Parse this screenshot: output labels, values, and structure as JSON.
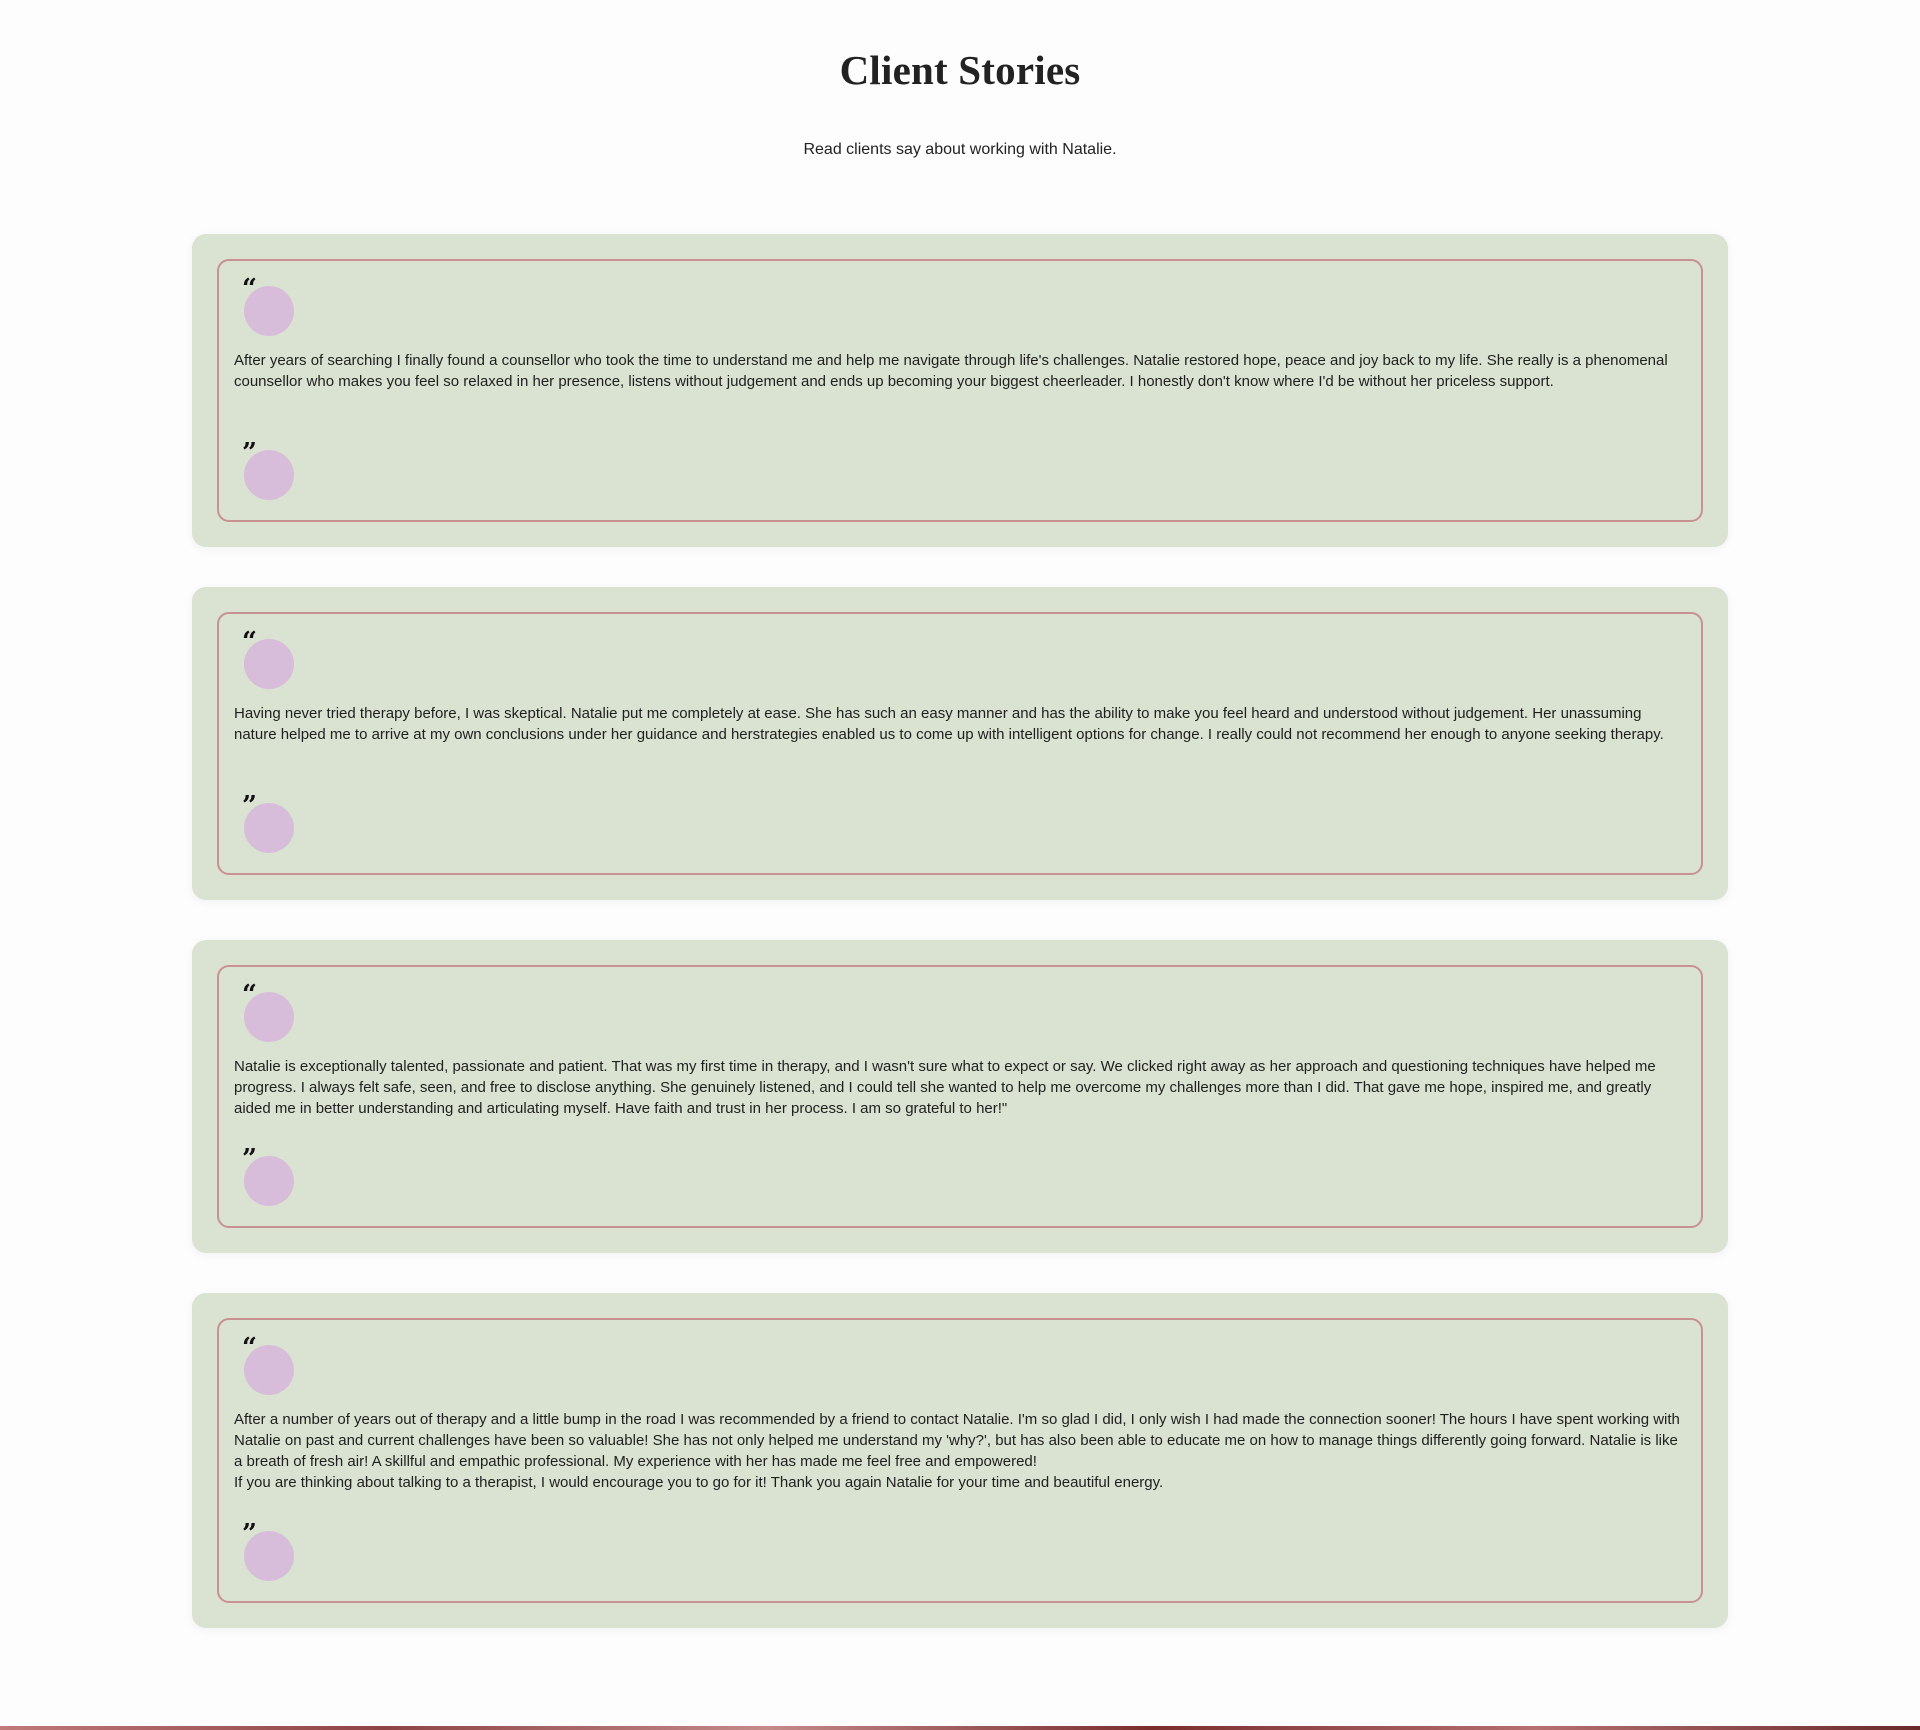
{
  "page": {
    "title": "Client Stories",
    "subtitle": "Read clients say about working with Natalie."
  },
  "quote_icons": {
    "open": "“",
    "close": "”",
    "open_icon": "opening-quote-icon",
    "close_icon": "closing-quote-icon"
  },
  "colors": {
    "background": "#fdfdfd",
    "card_background": "#dae2d1",
    "card_border": "#c79292",
    "quote_circle": "#d7bdd9",
    "text": "#1f1f1f"
  },
  "testimonials": [
    {
      "text": "After years of searching I finally found a counsellor who took the time to understand me and help me navigate through life's challenges. Natalie restored hope, peace and joy back to my life. She really is a phenomenal counsellor who makes you feel so relaxed in her presence, listens without judgement and ends up becoming your biggest cheerleader. I honestly don't know where I'd be without her priceless support."
    },
    {
      "text": "Having never tried therapy before, I was skeptical. Natalie put me completely at ease. She has such an easy manner and has the ability to make you feel heard and understood without judgement. Her unassuming nature helped me to arrive at my own conclusions under her guidance and herstrategies enabled us to come up with intelligent options for change. I really could not recommend her enough to anyone seeking therapy."
    },
    {
      "text": "Natalie is exceptionally talented, passionate and patient. That was my first time in therapy, and I wasn't sure what to expect or say. We clicked right away as her approach and questioning techniques have helped me progress. I always felt safe, seen, and free to disclose anything. She genuinely listened, and I could tell she wanted to help me overcome my challenges more than I did. That gave me hope, inspired me, and greatly aided me in better understanding and articulating myself. Have faith and trust in her process. I am so grateful to her!\""
    },
    {
      "text": "After a number of years out of therapy and a little bump in the road I was recommended by a friend to contact Natalie. I'm so glad I did, I only wish I had made the connection sooner! The hours I have spent working with Natalie on past and current challenges have been so valuable! She has not only helped me understand my 'why?', but has also been able to educate me on how to manage things differently going forward. Natalie is like a breath of fresh air! A skillful and empathic professional. My experience with her has made me feel free and empowered!\nIf you are thinking about talking to a therapist, I would encourage you to go for it! Thank you again Natalie for your time and beautiful energy."
    }
  ]
}
